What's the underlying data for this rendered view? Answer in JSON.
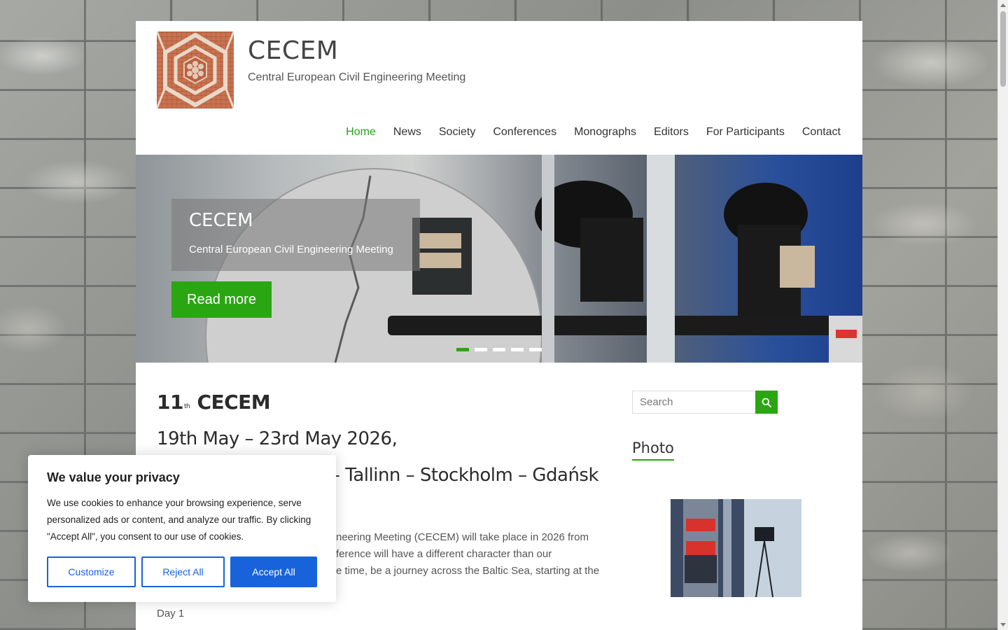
{
  "site": {
    "title": "CECEM",
    "tagline": "Central European Civil Engineering Meeting"
  },
  "nav": {
    "items": [
      {
        "label": "Home",
        "active": true
      },
      {
        "label": "News"
      },
      {
        "label": "Society"
      },
      {
        "label": "Conferences"
      },
      {
        "label": "Monographs"
      },
      {
        "label": "Editors"
      },
      {
        "label": "For Participants"
      },
      {
        "label": "Contact"
      }
    ]
  },
  "slider": {
    "title": "CECEM",
    "subtitle": "Central European Civil Engineering Meeting",
    "button": "Read more",
    "dots": 5,
    "active_dot": 1
  },
  "content": {
    "heading_number": "11",
    "heading_sup": "th",
    "heading_rest": "CECEM",
    "date_line": "19th May – 23rd May 2026,",
    "route_line": "– Tallinn – Stockholm – Gdańsk",
    "body_lines": [
      "neering Meeting (CECEM) will take place in 2026 from",
      "ference will have a different character than our",
      "e time, be a journey across the Baltic Sea, starting at the"
    ],
    "day_label": "Day 1"
  },
  "sidebar": {
    "search_placeholder": "Search",
    "widget_title": "Photo"
  },
  "cookie": {
    "title": "We value your privacy",
    "text": "We use cookies to enhance your browsing experience, serve personalized ads or content, and analyze our traffic. By clicking \"Accept All\", you consent to our use of cookies.",
    "customize": "Customize",
    "reject": "Reject All",
    "accept": "Accept All"
  },
  "colors": {
    "accent_green": "#2aa613",
    "cookie_blue": "#1863dc"
  },
  "icons": {
    "search": "search-icon"
  }
}
